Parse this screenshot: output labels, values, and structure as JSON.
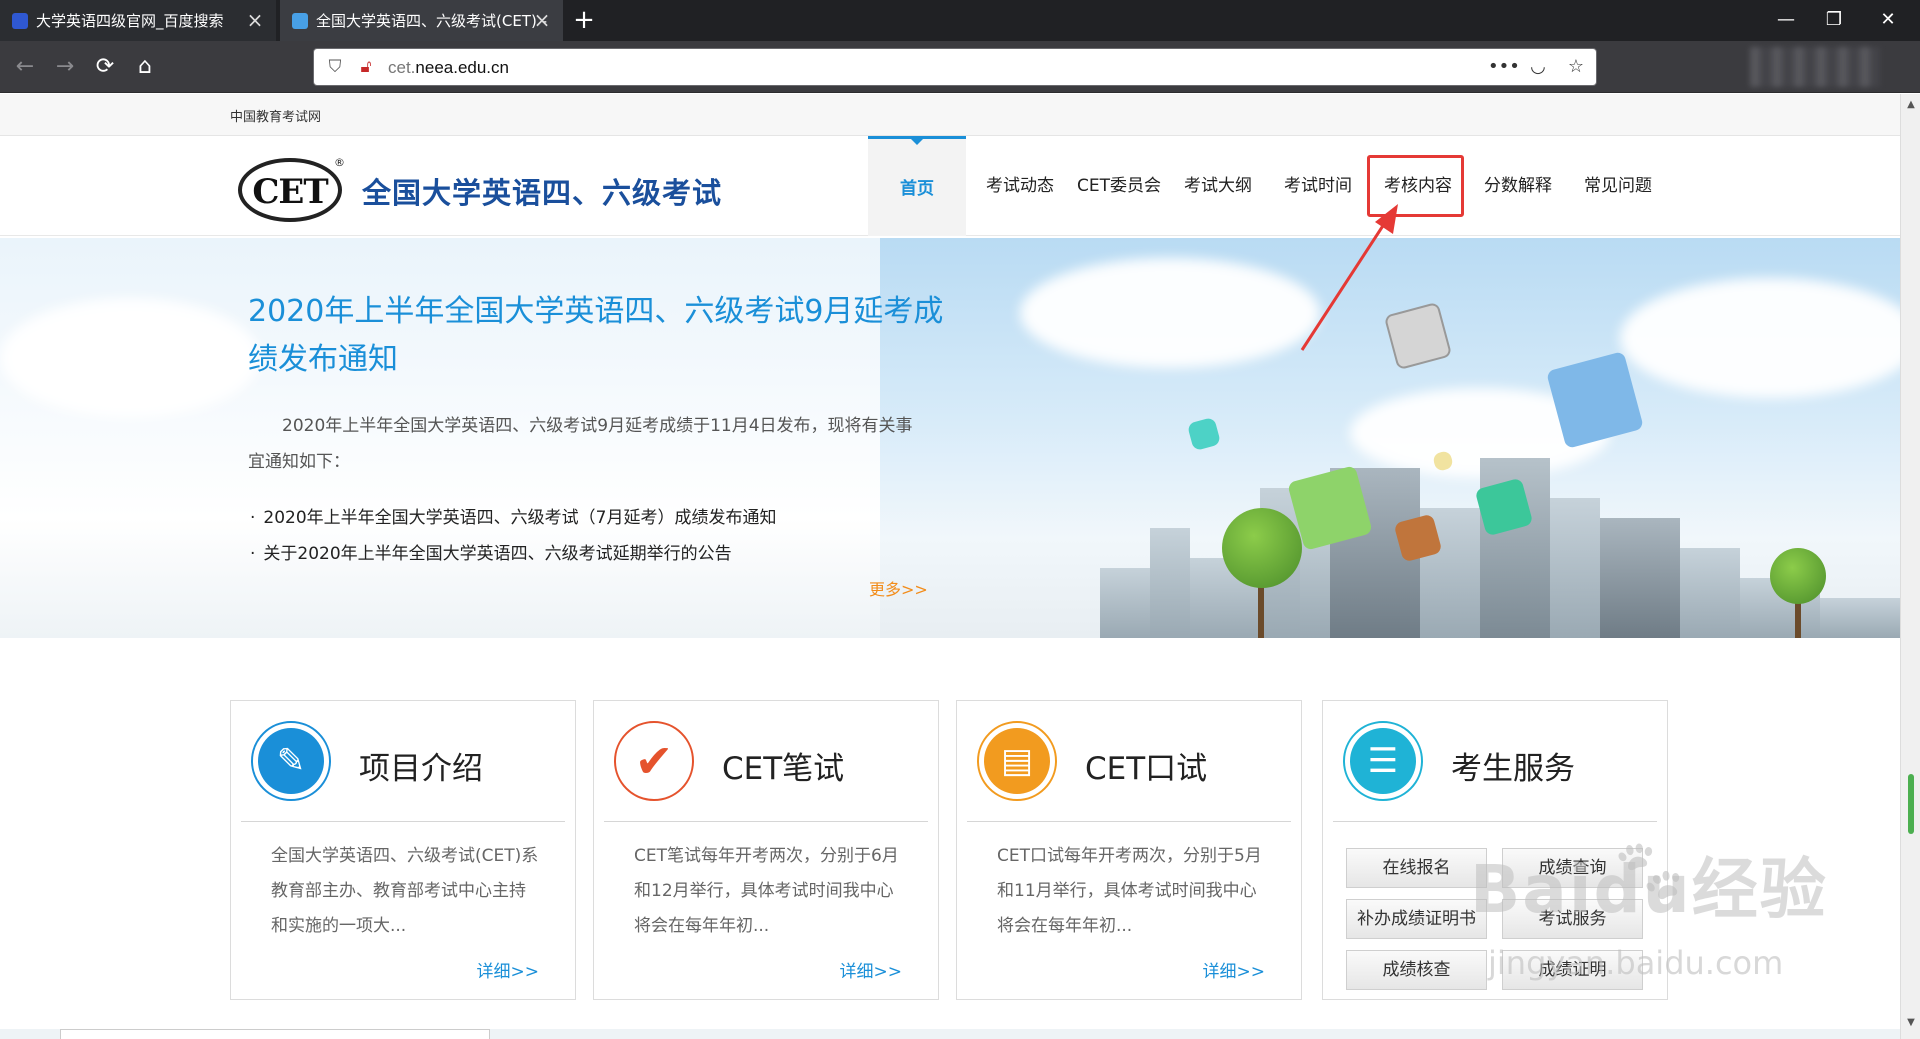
{
  "browser": {
    "tabs": [
      {
        "title": "大学英语四级官网_百度搜索",
        "active": false
      },
      {
        "title": "全国大学英语四、六级考试(CET) -",
        "active": true
      }
    ],
    "new_tab_icon": "plus-icon",
    "url_prefix": "cet.",
    "url_domain": "neea.edu.cn",
    "window_controls": [
      "minimize-icon",
      "restore-icon",
      "close-icon"
    ]
  },
  "topstrip": {
    "site_link": "中国教育考试网"
  },
  "header": {
    "logo_text": "CET",
    "logo_reg": "®",
    "site_name": "全国大学英语四、六级考试",
    "nav": [
      {
        "label": "首页",
        "active": true
      },
      {
        "label": "考试动态"
      },
      {
        "label": "CET委员会"
      },
      {
        "label": "考试大纲"
      },
      {
        "label": "考试时间"
      },
      {
        "label": "考核内容",
        "highlighted": true
      },
      {
        "label": "分数解释"
      },
      {
        "label": "常见问题"
      }
    ]
  },
  "banner": {
    "title": "2020年上半年全国大学英语四、六级考试9月延考成绩发布通知",
    "intro": "2020年上半年全国大学英语四、六级考试9月延考成绩于11月4日发布，现将有关事宜通知如下：",
    "links": [
      "2020年上半年全国大学英语四、六级考试（7月延考）成绩发布通知",
      "关于2020年上半年全国大学英语四、六级考试延期举行的公告"
    ],
    "more": "更多>>"
  },
  "cards": [
    {
      "title": "项目介绍",
      "text": "全国大学英语四、六级考试(CET)系教育部主办、教育部考试中心主持和实施的一项大...",
      "more": "详细>>",
      "icon": "document-edit-icon",
      "color": "#1a8fd8"
    },
    {
      "title": "CET笔试",
      "text": "CET笔试每年开考两次，分别于6月和12月举行，具体考试时间我中心将会在每年年初...",
      "more": "详细>>",
      "icon": "checkmark-icon",
      "color": "#e5532d"
    },
    {
      "title": "CET口试",
      "text": "CET口试每年开考两次，分别于5月和11月举行，具体考试时间我中心将会在每年年初...",
      "more": "详细>>",
      "icon": "form-pen-icon",
      "color": "#f29b1f"
    },
    {
      "title": "考生服务",
      "icon": "address-book-icon",
      "color": "#1fb3d6",
      "buttons": [
        "在线报名",
        "成绩查询",
        "补办成绩证明书",
        "考试服务",
        "成绩核查",
        "成绩证明"
      ]
    }
  ],
  "watermark": {
    "main": "Baidu经验",
    "sub": "jingyan.baidu.com"
  },
  "colors": {
    "accent": "#1a8fd8",
    "highlight": "#e53935",
    "more": "#f28c1a"
  }
}
